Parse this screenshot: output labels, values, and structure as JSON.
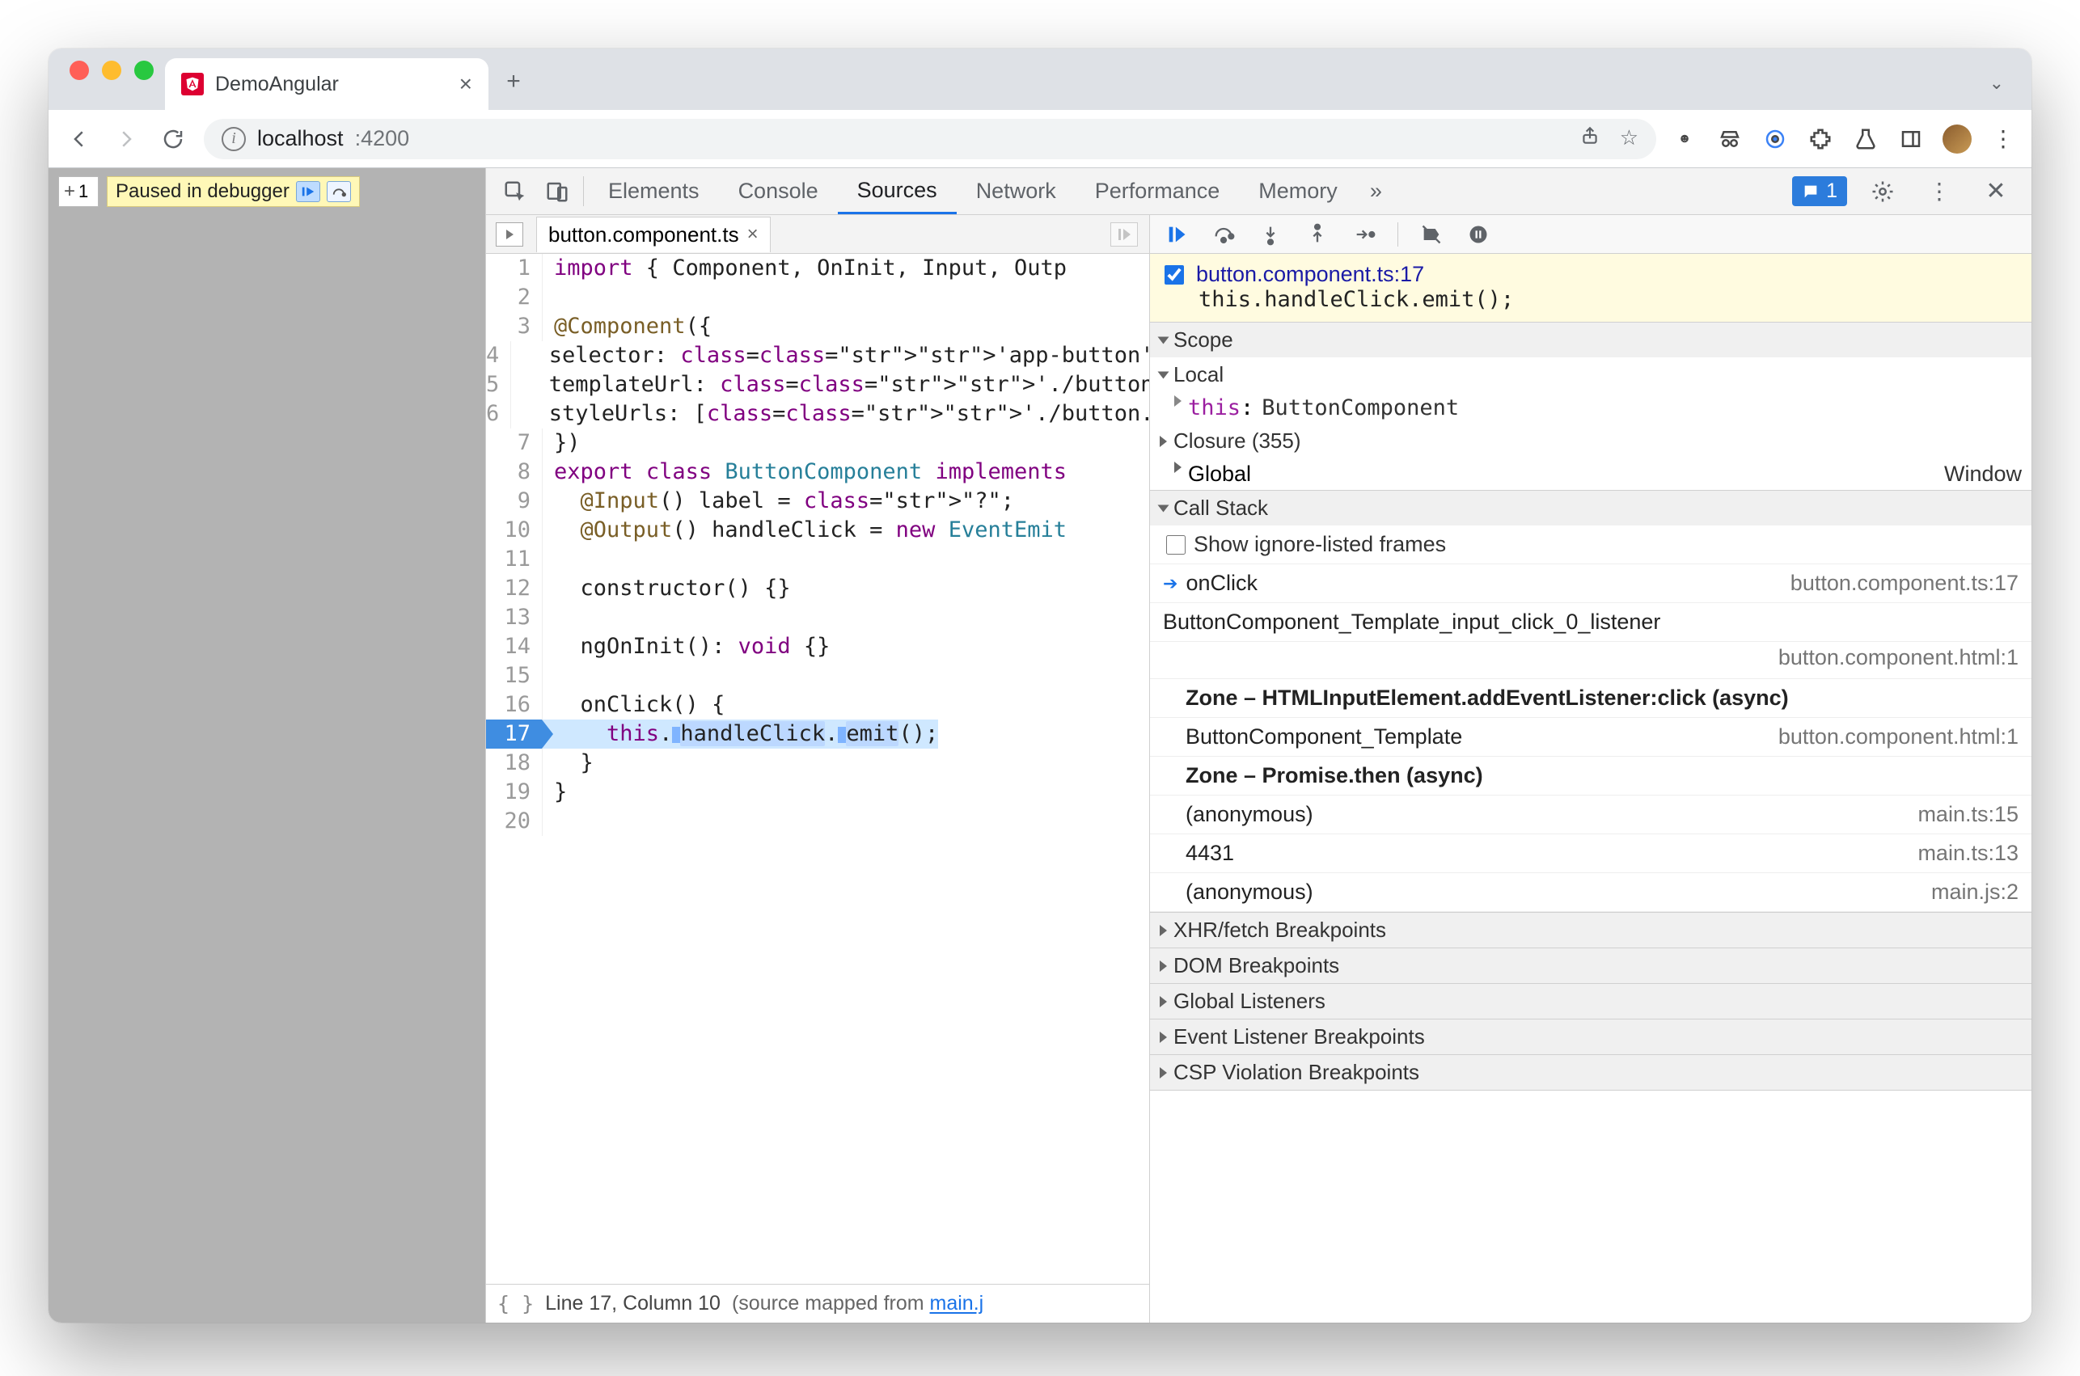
{
  "browser": {
    "tab_title": "DemoAngular",
    "url_host": "localhost",
    "url_rest": ":4200"
  },
  "page": {
    "input_value": "1",
    "paused_label": "Paused in debugger"
  },
  "devtools": {
    "tabs": [
      "Elements",
      "Console",
      "Sources",
      "Network",
      "Performance",
      "Memory"
    ],
    "active_tab": "Sources",
    "more_glyph": "»",
    "issues_count": "1"
  },
  "sources": {
    "file_tab": "button.component.ts",
    "status_line": "Line 17, Column 10",
    "status_mapped_prefix": "(source mapped from ",
    "status_mapped_link": "main.j",
    "lines": [
      {
        "n": 1,
        "raw": "import { Component, OnInit, Input, Outp"
      },
      {
        "n": 2,
        "raw": ""
      },
      {
        "n": 3,
        "raw": "@Component({"
      },
      {
        "n": 4,
        "raw": "  selector: 'app-button',"
      },
      {
        "n": 5,
        "raw": "  templateUrl: './button.component.html"
      },
      {
        "n": 6,
        "raw": "  styleUrls: ['./button.component.css']"
      },
      {
        "n": 7,
        "raw": "})"
      },
      {
        "n": 8,
        "raw": "export class ButtonComponent implements"
      },
      {
        "n": 9,
        "raw": "  @Input() label = \"?\";"
      },
      {
        "n": 10,
        "raw": "  @Output() handleClick = new EventEmit"
      },
      {
        "n": 11,
        "raw": ""
      },
      {
        "n": 12,
        "raw": "  constructor() {}"
      },
      {
        "n": 13,
        "raw": ""
      },
      {
        "n": 14,
        "raw": "  ngOnInit(): void {}"
      },
      {
        "n": 15,
        "raw": ""
      },
      {
        "n": 16,
        "raw": "  onClick() {"
      },
      {
        "n": 17,
        "raw": "    this.handleClick.emit();",
        "hl": true
      },
      {
        "n": 18,
        "raw": "  }"
      },
      {
        "n": 19,
        "raw": "}"
      },
      {
        "n": 20,
        "raw": ""
      }
    ]
  },
  "breakpoint": {
    "location": "button.component.ts:17",
    "code": "this.handleClick.emit();"
  },
  "scope": {
    "title": "Scope",
    "local_label": "Local",
    "this_key": "this",
    "this_val": "ButtonComponent",
    "closure_label": "Closure (355)",
    "global_label": "Global",
    "global_val": "Window"
  },
  "callstack": {
    "title": "Call Stack",
    "show_ignored_label": "Show ignore-listed frames",
    "frames": [
      {
        "name": "onClick",
        "loc": "button.component.ts:17",
        "current": true
      },
      {
        "name": "ButtonComponent_Template_input_click_0_listener",
        "loc": "button.component.html:1",
        "twoLine": true
      },
      {
        "name": "Zone – HTMLInputElement.addEventListener:click (async)",
        "zone": true
      },
      {
        "name": "ButtonComponent_Template",
        "loc": "button.component.html:1"
      },
      {
        "name": "Zone – Promise.then (async)",
        "zone": true
      },
      {
        "name": "(anonymous)",
        "loc": "main.ts:15"
      },
      {
        "name": "4431",
        "loc": "main.ts:13"
      },
      {
        "name": "(anonymous)",
        "loc": "main.js:2"
      }
    ]
  },
  "panels": {
    "xhr": "XHR/fetch Breakpoints",
    "dom": "DOM Breakpoints",
    "listeners": "Global Listeners",
    "event": "Event Listener Breakpoints",
    "csp": "CSP Violation Breakpoints"
  }
}
